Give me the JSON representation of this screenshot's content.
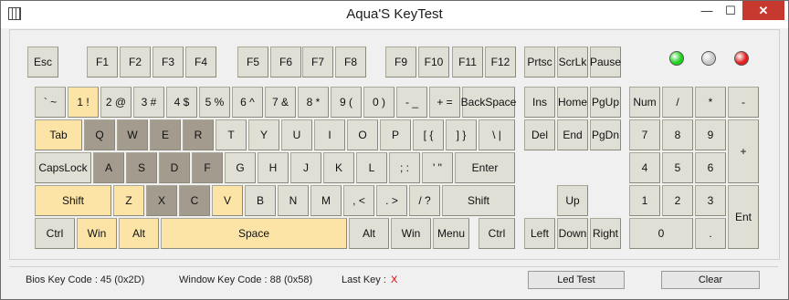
{
  "window": {
    "title": "Aqua'S KeyTest",
    "controls": {
      "minimize": "—",
      "maximize": "☐",
      "close": "✕"
    }
  },
  "colors": {
    "normal": "#e0dfd5",
    "pressed": "#a39b8e",
    "tested": "#fbe4a6"
  },
  "leds": [
    {
      "color": "#1ed21e",
      "state": "on"
    },
    {
      "color": "#c8c8c8",
      "state": "off"
    },
    {
      "color": "#e21f1f",
      "state": "on"
    }
  ],
  "keys": [
    {
      "label": "Esc",
      "state": "normal"
    },
    {
      "label": "F1",
      "state": "normal"
    },
    {
      "label": "F2",
      "state": "normal"
    },
    {
      "label": "F3",
      "state": "normal"
    },
    {
      "label": "F4",
      "state": "normal"
    },
    {
      "label": "F5",
      "state": "normal"
    },
    {
      "label": "F6",
      "state": "normal"
    },
    {
      "label": "F7",
      "state": "normal"
    },
    {
      "label": "F8",
      "state": "normal"
    },
    {
      "label": "F9",
      "state": "normal"
    },
    {
      "label": "F10",
      "state": "normal"
    },
    {
      "label": "F11",
      "state": "normal"
    },
    {
      "label": "F12",
      "state": "normal"
    },
    {
      "label": "Prtsc",
      "state": "normal"
    },
    {
      "label": "ScrLk",
      "state": "normal"
    },
    {
      "label": "Pause",
      "state": "normal"
    },
    {
      "label": "` ~",
      "state": "normal"
    },
    {
      "label": "1 !",
      "state": "tested"
    },
    {
      "label": "2 @",
      "state": "normal"
    },
    {
      "label": "3 #",
      "state": "normal"
    },
    {
      "label": "4 $",
      "state": "normal"
    },
    {
      "label": "5 %",
      "state": "normal"
    },
    {
      "label": "6 ^",
      "state": "normal"
    },
    {
      "label": "7 &",
      "state": "normal"
    },
    {
      "label": "8 *",
      "state": "normal"
    },
    {
      "label": "9 (",
      "state": "normal"
    },
    {
      "label": "0 )",
      "state": "normal"
    },
    {
      "label": "- _",
      "state": "normal"
    },
    {
      "label": "+ =",
      "state": "normal"
    },
    {
      "label": "BackSpace",
      "state": "normal"
    },
    {
      "label": "Ins",
      "state": "normal"
    },
    {
      "label": "Home",
      "state": "normal"
    },
    {
      "label": "PgUp",
      "state": "normal"
    },
    {
      "label": "Num",
      "state": "normal"
    },
    {
      "label": "/",
      "state": "normal"
    },
    {
      "label": "*",
      "state": "normal"
    },
    {
      "label": "-",
      "state": "normal"
    },
    {
      "label": "Tab",
      "state": "tested"
    },
    {
      "label": "Q",
      "state": "pressed"
    },
    {
      "label": "W",
      "state": "pressed"
    },
    {
      "label": "E",
      "state": "pressed"
    },
    {
      "label": "R",
      "state": "pressed"
    },
    {
      "label": "T",
      "state": "normal"
    },
    {
      "label": "Y",
      "state": "normal"
    },
    {
      "label": "U",
      "state": "normal"
    },
    {
      "label": "I",
      "state": "normal"
    },
    {
      "label": "O",
      "state": "normal"
    },
    {
      "label": "P",
      "state": "normal"
    },
    {
      "label": "[ {",
      "state": "normal"
    },
    {
      "label": "] }",
      "state": "normal"
    },
    {
      "label": "\\ |",
      "state": "normal"
    },
    {
      "label": "Del",
      "state": "normal"
    },
    {
      "label": "End",
      "state": "normal"
    },
    {
      "label": "PgDn",
      "state": "normal"
    },
    {
      "label": "7",
      "state": "normal"
    },
    {
      "label": "8",
      "state": "normal"
    },
    {
      "label": "9",
      "state": "normal"
    },
    {
      "label": "+",
      "state": "normal"
    },
    {
      "label": "CapsLock",
      "state": "normal"
    },
    {
      "label": "A",
      "state": "pressed"
    },
    {
      "label": "S",
      "state": "pressed"
    },
    {
      "label": "D",
      "state": "pressed"
    },
    {
      "label": "F",
      "state": "pressed"
    },
    {
      "label": "G",
      "state": "normal"
    },
    {
      "label": "H",
      "state": "normal"
    },
    {
      "label": "J",
      "state": "normal"
    },
    {
      "label": "K",
      "state": "normal"
    },
    {
      "label": "L",
      "state": "normal"
    },
    {
      "label": "; :",
      "state": "normal"
    },
    {
      "label": "' \"",
      "state": "normal"
    },
    {
      "label": "Enter",
      "state": "normal"
    },
    {
      "label": "4",
      "state": "normal"
    },
    {
      "label": "5",
      "state": "normal"
    },
    {
      "label": "6",
      "state": "normal"
    },
    {
      "label": "Shift",
      "state": "tested"
    },
    {
      "label": "Z",
      "state": "tested"
    },
    {
      "label": "X",
      "state": "pressed"
    },
    {
      "label": "C",
      "state": "pressed"
    },
    {
      "label": "V",
      "state": "tested"
    },
    {
      "label": "B",
      "state": "normal"
    },
    {
      "label": "N",
      "state": "normal"
    },
    {
      "label": "M",
      "state": "normal"
    },
    {
      "label": ", <",
      "state": "normal"
    },
    {
      "label": ". >",
      "state": "normal"
    },
    {
      "label": "/ ?",
      "state": "normal"
    },
    {
      "label": "Shift",
      "state": "normal"
    },
    {
      "label": "Up",
      "state": "normal"
    },
    {
      "label": "1",
      "state": "normal"
    },
    {
      "label": "2",
      "state": "normal"
    },
    {
      "label": "3",
      "state": "normal"
    },
    {
      "label": "Ent",
      "state": "normal"
    },
    {
      "label": "Ctrl",
      "state": "normal"
    },
    {
      "label": "Win",
      "state": "tested"
    },
    {
      "label": "Alt",
      "state": "tested"
    },
    {
      "label": "Space",
      "state": "tested"
    },
    {
      "label": "Alt",
      "state": "normal"
    },
    {
      "label": "Win",
      "state": "normal"
    },
    {
      "label": "Menu",
      "state": "normal"
    },
    {
      "label": "Ctrl",
      "state": "normal"
    },
    {
      "label": "Left",
      "state": "normal"
    },
    {
      "label": "Down",
      "state": "normal"
    },
    {
      "label": "Right",
      "state": "normal"
    },
    {
      "label": "0",
      "state": "normal"
    },
    {
      "label": ".",
      "state": "normal"
    }
  ],
  "status": {
    "bios_key_code": "Bios Key Code : 45 (0x2D)",
    "window_key_code": "Window Key Code : 88 (0x58)",
    "last_key_label": "Last Key :",
    "last_key_value": "X",
    "led_test_button": "Led Test",
    "clear_button": "Clear"
  }
}
